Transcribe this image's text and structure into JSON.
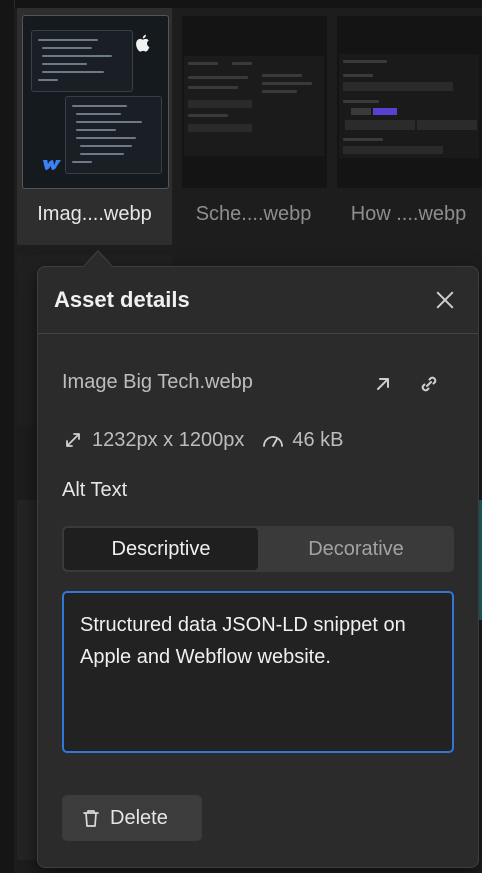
{
  "thumbnails": [
    {
      "label": "Imag....webp",
      "selected": true
    },
    {
      "label": "Sche....webp",
      "selected": false
    },
    {
      "label": "How ....webp",
      "selected": false
    }
  ],
  "asset_details": {
    "title": "Asset details",
    "close_icon": "close-icon",
    "file_name": "Image Big Tech.webp",
    "open_icon": "external-link-icon",
    "copy_link_icon": "link-icon",
    "dimensions": "1232px x 1200px",
    "dimensions_icon": "resize-arrows-icon",
    "file_size": "46 kB",
    "file_size_icon": "gauge-icon",
    "alt_text_label": "Alt Text",
    "alt_mode": {
      "options": [
        "Descriptive",
        "Decorative"
      ],
      "selected": "Descriptive"
    },
    "alt_text_value": "Structured data JSON-LD snippet on Apple and Webflow website.",
    "delete_label": "Delete",
    "delete_icon": "trash-icon"
  },
  "colors": {
    "accent": "#2f78d6",
    "panel_bg": "#2b2b2b",
    "page_bg": "#1e1e1e"
  }
}
